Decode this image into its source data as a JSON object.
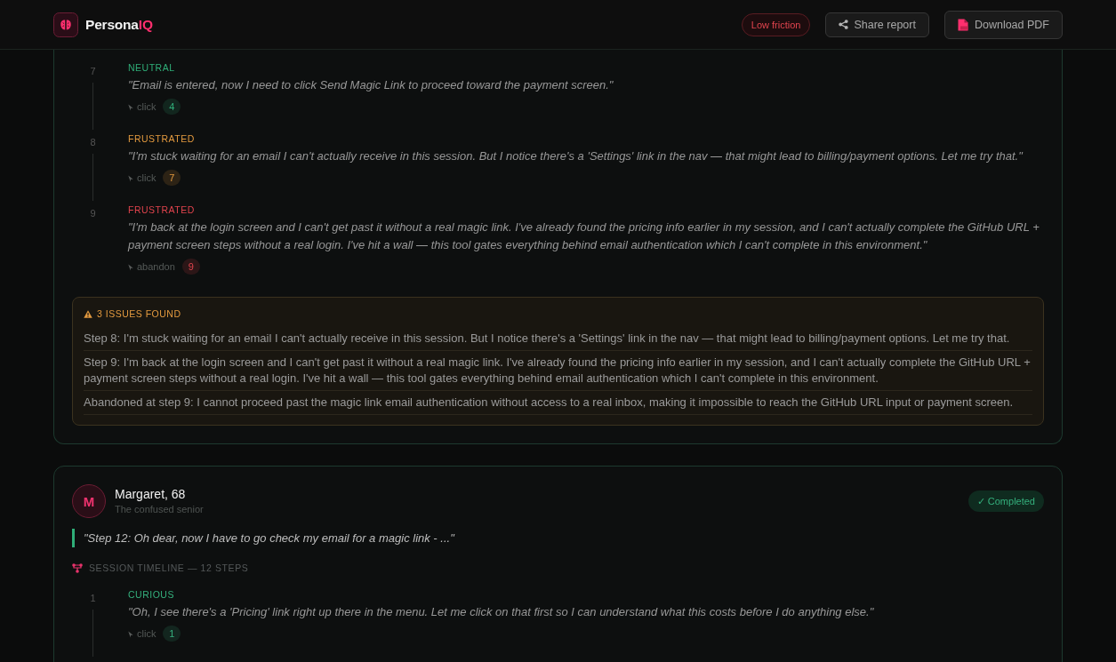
{
  "header": {
    "brand": {
      "text": "Persona",
      "accent": "IQ"
    },
    "friction_tag": "Low friction",
    "buttons": [
      {
        "label": "Share report",
        "kind": "share"
      },
      {
        "label": "Download PDF",
        "kind": "pdf"
      }
    ]
  },
  "sessions": [
    {
      "steps": [
        {
          "number": "7",
          "mood": "NEUTRAL",
          "color": "#2fae78",
          "quote": "\"Email is entered, now I need to click Send Magic Link to proceed toward the payment screen.\"",
          "action": "click",
          "count": "4"
        },
        {
          "number": "8",
          "mood": "FRUSTRATED",
          "color": "#e39a3f",
          "quote": "\"I'm stuck waiting for an email I can't actually receive in this session. But I notice there's a 'Settings' link in the nav — that might lead to billing/payment options. Let me try that.\"",
          "action": "click",
          "count": "7"
        },
        {
          "number": "9",
          "mood": "FRUSTRATED",
          "color": "#e0434d",
          "quote": "\"I'm back at the login screen and I can't get past it without a real magic link. I've already found the pricing info earlier in my session, and I can't actually complete the GitHub URL + payment screen steps without a real login. I've hit a wall — this tool gates everything behind email authentication which I can't complete in this environment.\"",
          "action": "abandon",
          "count": "9"
        }
      ],
      "issues": {
        "title": "3 ISSUES FOUND",
        "items": [
          "Step 8: I'm stuck waiting for an email I can't actually receive in this session. But I notice there's a 'Settings' link in the nav — that might lead to billing/payment options. Let me try that.",
          "Step 9: I'm back at the login screen and I can't get past it without a real magic link. I've already found the pricing info earlier in my session, and I can't actually complete the GitHub URL + payment screen steps without a real login. I've hit a wall — this tool gates everything behind email authentication which I can't complete in this environment.",
          "Abandoned at step 9: I cannot proceed past the magic link email authentication without access to a real inbox, making it impossible to reach the GitHub URL input or payment screen."
        ]
      }
    },
    {
      "avatar": "M",
      "name": "Margaret, 68",
      "subtitle": "The confused senior",
      "status": "✓ Completed",
      "quote": "\"Step 12: Oh dear, now I have to go check my email for a magic link - ...\"",
      "timeline_title": "SESSION TIMELINE — 12 STEPS",
      "steps": [
        {
          "number": "1",
          "mood": "CURIOUS",
          "color": "#35b07d",
          "quote": "\"Oh, I see there's a 'Pricing' link right up there in the menu. Let me click on that first so I can understand what this costs before I do anything else.\"",
          "action": "click",
          "count": "1"
        }
      ]
    }
  ]
}
